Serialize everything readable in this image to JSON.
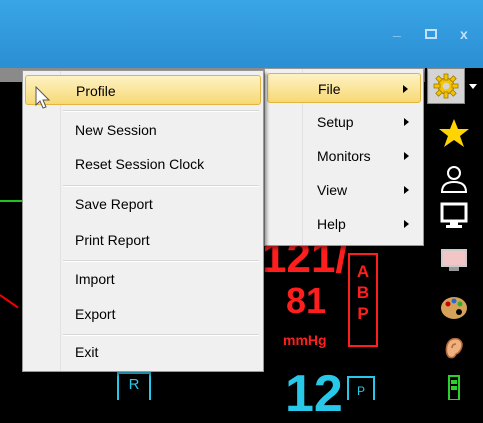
{
  "window": {
    "controls": {
      "minimize": "_",
      "maximize": "▫",
      "close": "x"
    }
  },
  "monitor": {
    "abp": {
      "systolic": "121/",
      "diastolic": "81",
      "unit": "mmHg",
      "box_letters": [
        "A",
        "B",
        "P"
      ]
    },
    "r_label": "R",
    "second_value": "12",
    "second_box": "P"
  },
  "toolbar": {
    "icons": [
      "settings-gear-icon",
      "star-icon",
      "person-icon",
      "monitor-icon",
      "screen-icon",
      "palette-icon",
      "ear-icon",
      "battery-icon"
    ],
    "colors": {
      "star": "#ffd400",
      "gear": "#ffd400"
    }
  },
  "menu_main": {
    "items": [
      {
        "label": "File",
        "submenu": true,
        "highlighted": true
      },
      {
        "label": "Setup",
        "submenu": true
      },
      {
        "label": "Monitors",
        "submenu": true
      },
      {
        "label": "View",
        "submenu": true
      },
      {
        "label": "Help",
        "submenu": true
      }
    ]
  },
  "menu_file": {
    "items": [
      {
        "label": "Profile",
        "highlighted": true
      },
      {
        "label": "New Session"
      },
      {
        "label": "Reset Session Clock"
      },
      {
        "label": "Save Report"
      },
      {
        "label": "Print Report"
      },
      {
        "label": "Import"
      },
      {
        "label": "Export"
      },
      {
        "label": "Exit"
      }
    ]
  },
  "colors": {
    "titlebar": "#2b8fd3",
    "menu_bg": "#f0f0f0",
    "highlight": "#f7d974",
    "abp_red": "#ff1e1e",
    "cyan": "#28c8e8"
  }
}
